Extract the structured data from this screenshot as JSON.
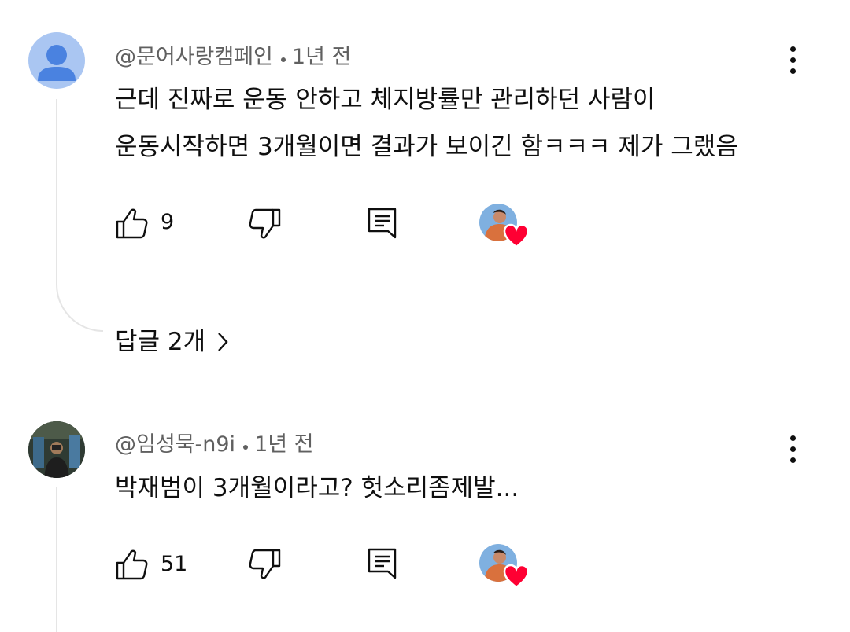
{
  "comments": [
    {
      "author": "@문어사랑캠페인",
      "time": "1년 전",
      "lines": [
        "근데 진짜로 운동 안하고 체지방률만 관리하던 사람이",
        "운동시작하면 3개월이면 결과가 보이긴 함ㅋㅋㅋ 제가 그랬음"
      ],
      "like_count": "9",
      "replies_label": "답글 2개",
      "avatar_icon": "default-user-avatar",
      "hearted_by_creator": true
    },
    {
      "author": "@임성묵-n9i",
      "time": "1년 전",
      "lines": [
        "박재범이 3개월이라고? 헛소리좀제발..."
      ],
      "like_count": "51",
      "avatar_icon": "photo-avatar",
      "hearted_by_creator": true
    }
  ],
  "icons": {
    "like": "thumbs-up-icon",
    "dislike": "thumbs-down-icon",
    "reply": "reply-comment-icon",
    "more": "more-vertical-icon",
    "heart": "heart-icon",
    "chevron": "chevron-right-icon"
  },
  "colors": {
    "heart": "#ff0033",
    "secondary_text": "#606060",
    "default_avatar_bg": "#aac6f2",
    "default_avatar_fg": "#4a82e0"
  }
}
